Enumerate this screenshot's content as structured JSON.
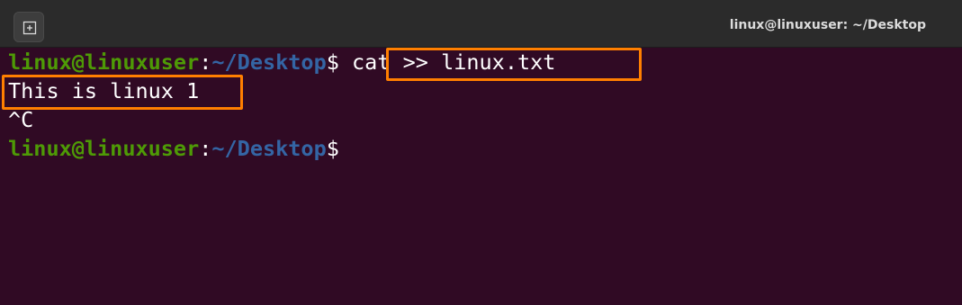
{
  "window": {
    "title": "linux@linuxuser: ~/Desktop",
    "new_tab_icon": "new-tab-icon"
  },
  "terminal": {
    "lines": [
      {
        "user": "linux@linuxuser",
        "colon": ":",
        "path": "~/Desktop",
        "dollar": "$",
        "command": " cat >> linux.txt"
      },
      {
        "output": "This is linux 1"
      },
      {
        "output": "^C"
      },
      {
        "user": "linux@linuxuser",
        "colon": ":",
        "path": "~/Desktop",
        "dollar": "$",
        "command": ""
      }
    ]
  },
  "colors": {
    "background": "#300a24",
    "user": "#4e9a06",
    "path": "#3465a4",
    "highlight": "#ff7f00"
  }
}
